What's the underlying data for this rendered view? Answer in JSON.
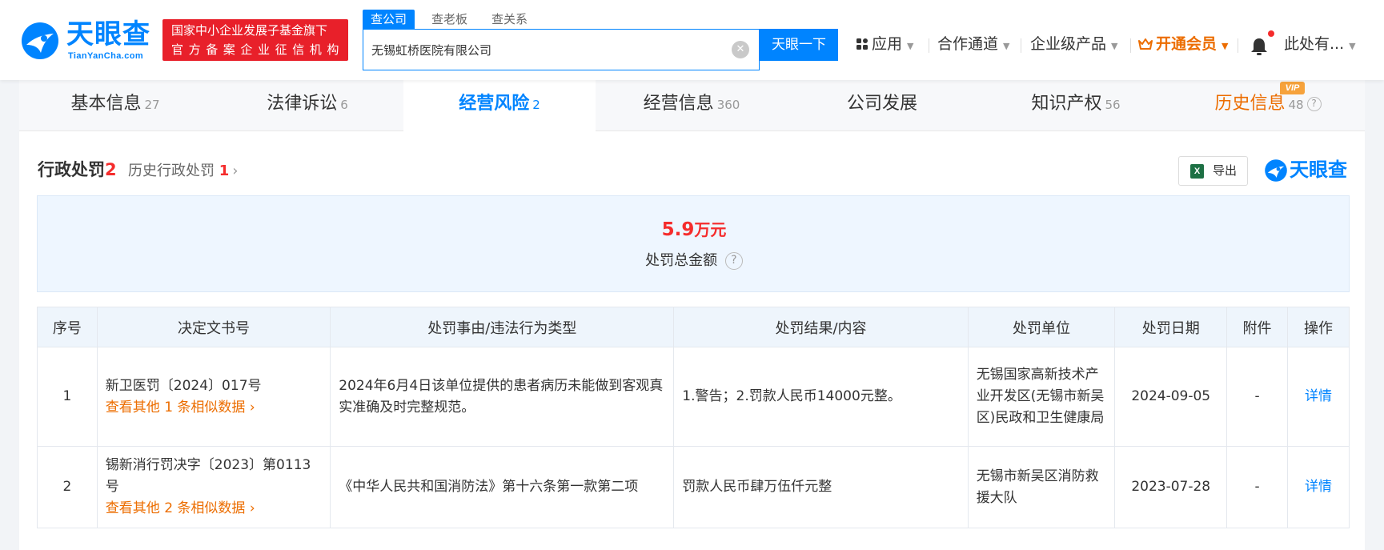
{
  "header": {
    "logo_name": "天眼查",
    "logo_domain": "TianYanCha.com",
    "fund_badge_line1": "国家中小企业发展子基金旗下",
    "fund_badge_line2": "官方备案企业征信机构",
    "search_tabs": [
      "查公司",
      "查老板",
      "查关系"
    ],
    "search_value": "无锡虹桥医院有限公司",
    "search_button": "天眼一下",
    "nav": {
      "apps": "应用",
      "cooperation": "合作通道",
      "enterprise": "企业级产品",
      "vip": "开通会员",
      "user": "此处有..."
    }
  },
  "tabs": [
    {
      "label": "基本信息",
      "count": "27"
    },
    {
      "label": "法律诉讼",
      "count": "6"
    },
    {
      "label": "经营风险",
      "count": "2"
    },
    {
      "label": "经营信息",
      "count": "360"
    },
    {
      "label": "公司发展",
      "count": ""
    },
    {
      "label": "知识产权",
      "count": "56"
    },
    {
      "label": "历史信息",
      "count": "48"
    }
  ],
  "vip_badge": "VIP",
  "section": {
    "title": "行政处罚",
    "title_count": "2",
    "history_label": "历史行政处罚",
    "history_count": "1",
    "export_label": "导出",
    "excel_glyph": "X",
    "watermark_name": "天眼查"
  },
  "summary": {
    "amount": "5.9",
    "unit": "万元",
    "label": "处罚总金额"
  },
  "table": {
    "headers": [
      "序号",
      "决定文书号",
      "处罚事由/违法行为类型",
      "处罚结果/内容",
      "处罚单位",
      "处罚日期",
      "附件",
      "操作"
    ],
    "rows": [
      {
        "index": "1",
        "doc_no": "新卫医罚〔2024〕017号",
        "more": "查看其他 1 条相似数据",
        "reason": "2024年6月4日该单位提供的患者病历未能做到客观真实准确及时完整规范。",
        "result": "1.警告；2.罚款人民币14000元整。",
        "unit": "无锡国家高新技术产业开发区(无锡市新吴区)民政和卫生健康局",
        "date": "2024-09-05",
        "attachment": "-",
        "action": "详情"
      },
      {
        "index": "2",
        "doc_no": "锡新消行罚决字〔2023〕第0113号",
        "more": "查看其他 2 条相似数据",
        "reason": "《中华人民共和国消防法》第十六条第一款第二项",
        "result": "罚款人民币肆万伍仟元整",
        "unit": "无锡市新吴区消防救援大队",
        "date": "2023-07-28",
        "attachment": "-",
        "action": "详情"
      }
    ]
  },
  "colors": {
    "brand_blue": "#0084ff",
    "badge_red": "#e8202a",
    "highlight_orange": "#ec6d00",
    "amount_red": "#f52c2c"
  }
}
